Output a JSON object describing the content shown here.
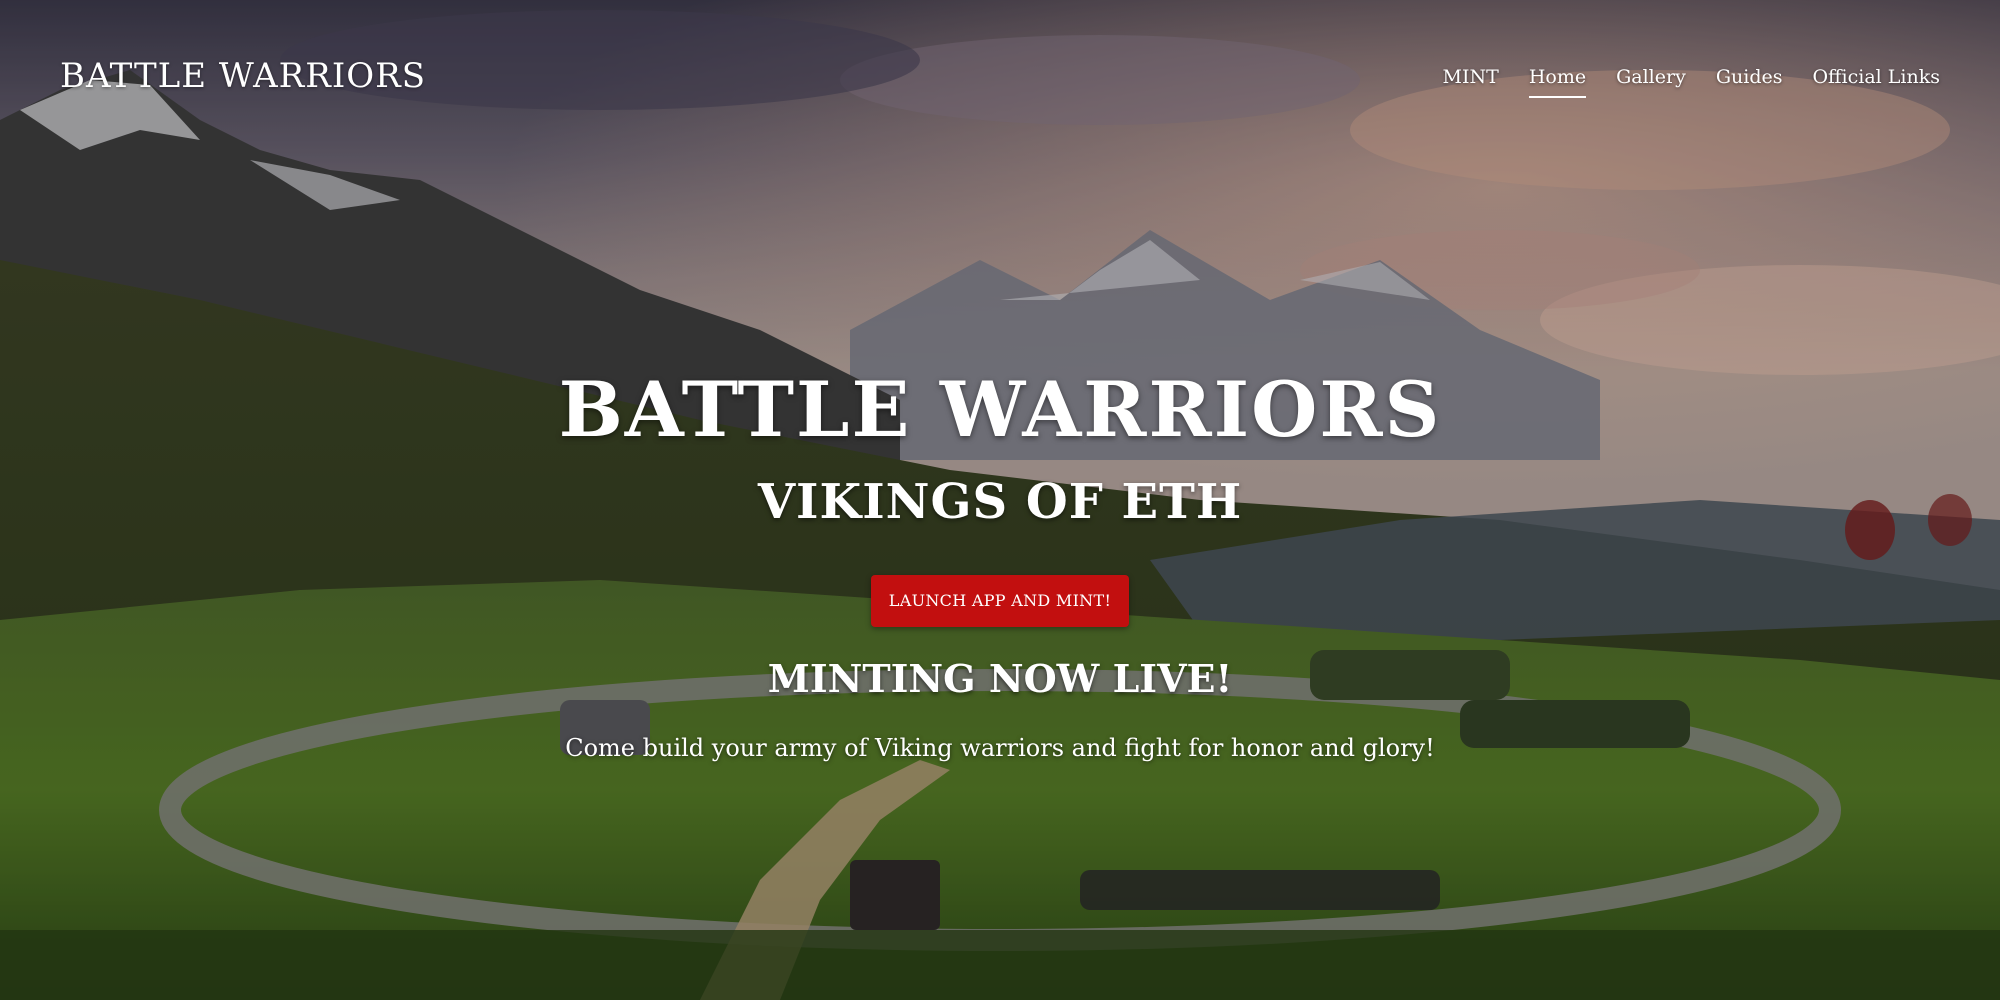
{
  "brand": {
    "logo_text": "BATTLE WARRIORS"
  },
  "nav": {
    "items": [
      {
        "label": "MINT",
        "active": false
      },
      {
        "label": "Home",
        "active": true
      },
      {
        "label": "Gallery",
        "active": false
      },
      {
        "label": "Guides",
        "active": false
      },
      {
        "label": "Official Links",
        "active": false
      }
    ]
  },
  "hero": {
    "title": "BATTLE WARRIORS",
    "subtitle": "VIKINGS OF ETH",
    "cta_label": "LAUNCH APP AND MINT!",
    "status": "MINTING NOW LIVE!",
    "tagline": "Come build your army of Viking warriors and fight for honor and glory!"
  },
  "colors": {
    "cta_background": "#c20f0f",
    "text": "#ffffff"
  }
}
